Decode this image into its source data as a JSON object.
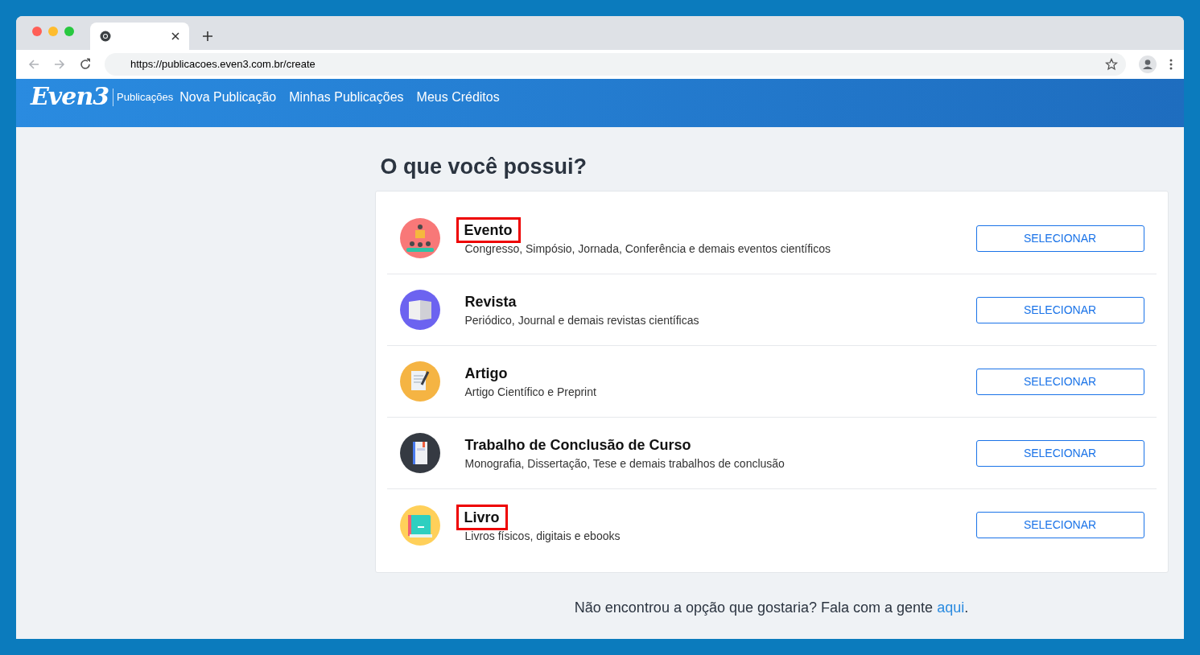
{
  "browser": {
    "url": "https://publicacoes.even3.com.br/create"
  },
  "nav": {
    "logo": "Even3",
    "section": "Publicações",
    "links": [
      "Nova Publicação",
      "Minhas Publicações",
      "Meus Créditos"
    ]
  },
  "heading": "O que você possui?",
  "options": [
    {
      "kind": "event",
      "title": "Evento",
      "description": "Congresso, Simpósio, Jornada, Conferência e demais eventos científicos",
      "button": "SELECIONAR",
      "highlighted": true
    },
    {
      "kind": "magazine",
      "title": "Revista",
      "description": "Periódico, Journal e demais revistas científicas",
      "button": "SELECIONAR",
      "highlighted": false
    },
    {
      "kind": "article",
      "title": "Artigo",
      "description": "Artigo Científico e Preprint",
      "button": "SELECIONAR",
      "highlighted": false
    },
    {
      "kind": "thesis",
      "title": "Trabalho de Conclusão de Curso",
      "description": "Monografia, Dissertação, Tese e demais trabalhos de conclusão",
      "button": "SELECIONAR",
      "highlighted": false
    },
    {
      "kind": "book",
      "title": "Livro",
      "description": "Livros físicos, digitais e ebooks",
      "button": "SELECIONAR",
      "highlighted": true
    }
  ],
  "footer": {
    "text": "Não encontrou a opção que gostaria? Fala com a gente ",
    "link": "aqui",
    "end": "."
  }
}
